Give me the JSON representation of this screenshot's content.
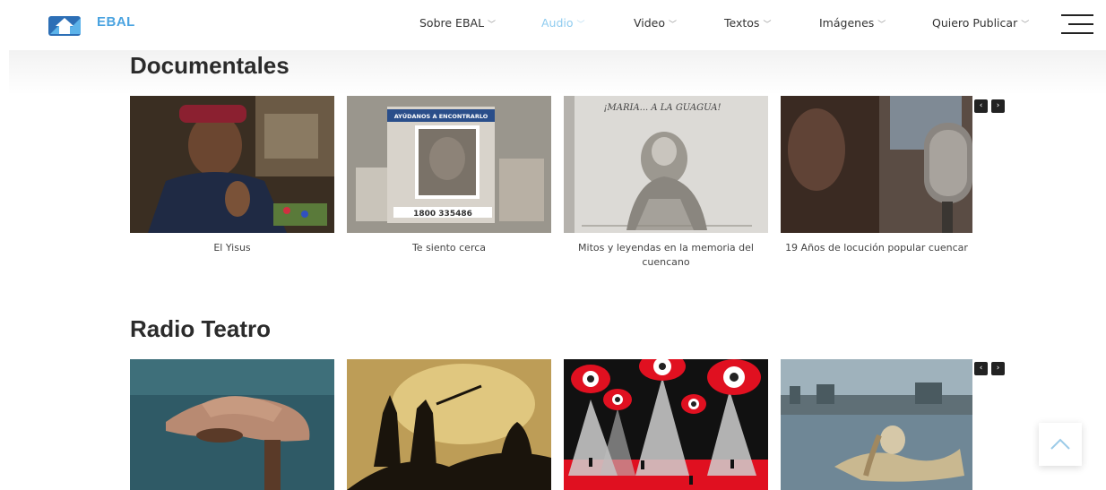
{
  "brand": {
    "name": "EBAL"
  },
  "nav": [
    {
      "label": "Sobre EBAL",
      "active": false
    },
    {
      "label": "Audio",
      "active": true
    },
    {
      "label": "Video",
      "active": false
    },
    {
      "label": "Textos",
      "active": false
    },
    {
      "label": "Imágenes",
      "active": false
    },
    {
      "label": "Quiero Publicar",
      "active": false
    }
  ],
  "sections": [
    {
      "title": "Documentales",
      "items": [
        {
          "caption": "El Yisus"
        },
        {
          "caption": "Te siento cerca",
          "poster_text": "AYÚDANOS A ENCONTRARLO",
          "poster_phone": "1800 335486"
        },
        {
          "caption": "Mitos y leyendas en la memoria del cuencano",
          "image_text": "¡MARIA... A LA GUAGUA!"
        },
        {
          "caption": "19 Años de locución popular cuencar"
        }
      ]
    },
    {
      "title": "Radio Teatro",
      "items": [
        {
          "caption": ""
        },
        {
          "caption": ""
        },
        {
          "caption": ""
        },
        {
          "caption": ""
        }
      ]
    }
  ],
  "carousel": {
    "prev_icon": "‹",
    "next_icon": "›"
  },
  "icons": {
    "menu": "hamburger-icon",
    "scroll_top": "chevron-up-icon",
    "logo": "ebal-logo-icon"
  },
  "colors": {
    "brand": "#4aa3e0",
    "active_nav": "#8ecbef",
    "text": "#2b2b2b"
  }
}
